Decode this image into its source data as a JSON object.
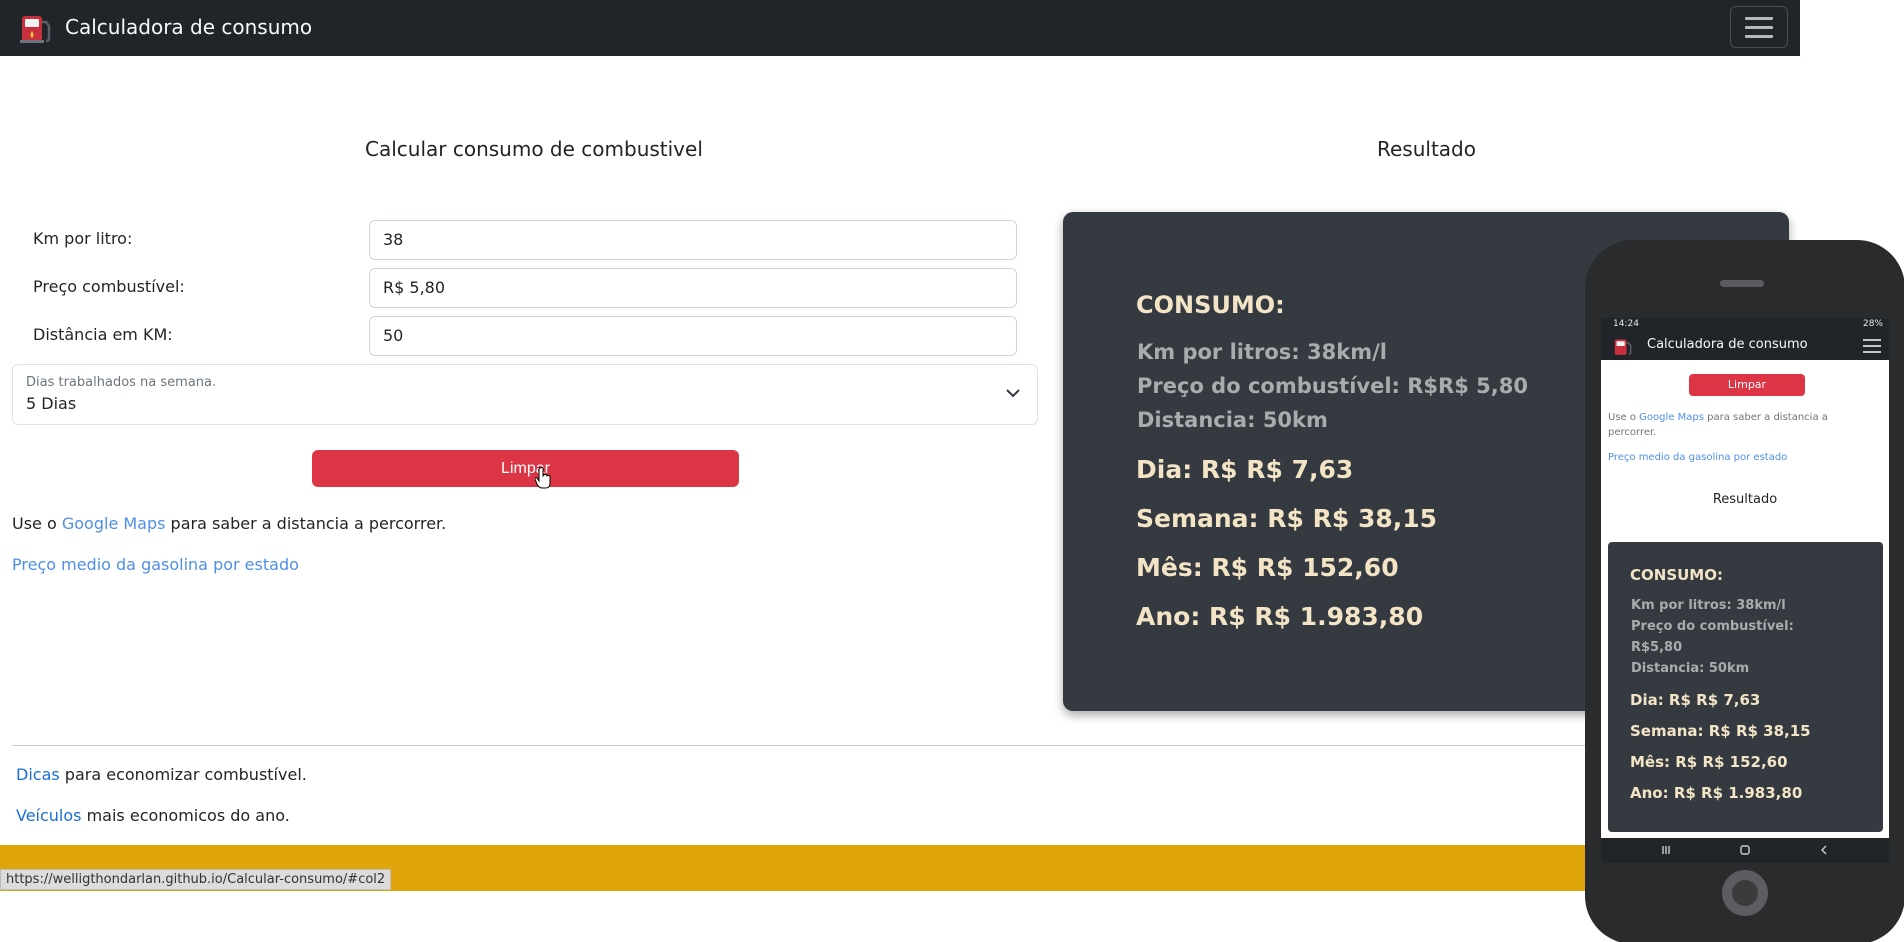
{
  "navbar": {
    "title": "Calculadora de consumo",
    "logo_icon": "fuel-pump-icon",
    "menu_icon": "hamburger-menu-icon"
  },
  "form": {
    "heading": "Calcular consumo de combustivel",
    "km_label": "Km por litro:",
    "km_value": "38",
    "preco_label": "Preço combustível:",
    "preco_value": "R$ 5,80",
    "distancia_label": "Distância em KM:",
    "distancia_value": "50",
    "dias_floating_label": "Dias trabalhados na semana.",
    "dias_value": "5 Dias",
    "limpar_button": "Limpar"
  },
  "links": {
    "maps_prefix": "Use o ",
    "maps_link": "Google Maps",
    "maps_suffix": " para saber a distancia a percorrer.",
    "preco_medio": "Preço medio da gasolina por estado",
    "dicas_link": "Dicas",
    "dicas_suffix": " para economizar combustível.",
    "veiculos_link": "Veículos",
    "veiculos_suffix": " mais economicos do ano."
  },
  "result": {
    "heading": "Resultado",
    "consumo_title": "CONSUMO:",
    "km_line": "Km por litros: 38km/l",
    "preco_line": "Preço do combustível: R$R$ 5,80",
    "distancia_line": "Distancia: 50km",
    "dia": "Dia: R$ R$ 7,63",
    "semana": "Semana: R$ R$ 38,15",
    "mes": "Mês: R$ R$ 152,60",
    "ano": "Ano: R$ R$ 1.983,80"
  },
  "status_bar_url": "https://welligthondarlan.github.io/Calcular-consumo/#col2",
  "phone": {
    "time": "14:24",
    "battery": "28%",
    "title": "Calculadora de consumo",
    "limpar_button": "Limpar",
    "maps_prefix": "Use o ",
    "maps_link": "Google Maps",
    "maps_suffix": " para saber a distancia a percorrer.",
    "preco_medio": "Preço medio da gasolina por estado",
    "resultado": "Resultado",
    "consumo_title": "CONSUMO:",
    "km_line": "Km por litros: 38km/l",
    "preco_line_1": "Preço do combustível:",
    "preco_line_2": "R$5,80",
    "distancia_line": "Distancia: 50km",
    "dia": "Dia: R$ R$ 7,63",
    "semana": "Semana: R$ R$ 38,15",
    "mes": "Mês: R$ R$ 152,60",
    "ano": "Ano: R$ R$ 1.983,80"
  },
  "colors": {
    "navbar": "#212529",
    "danger": "#dc3545",
    "card": "#343a40",
    "footer": "#e0a50a",
    "link": "#4f8fe8"
  }
}
